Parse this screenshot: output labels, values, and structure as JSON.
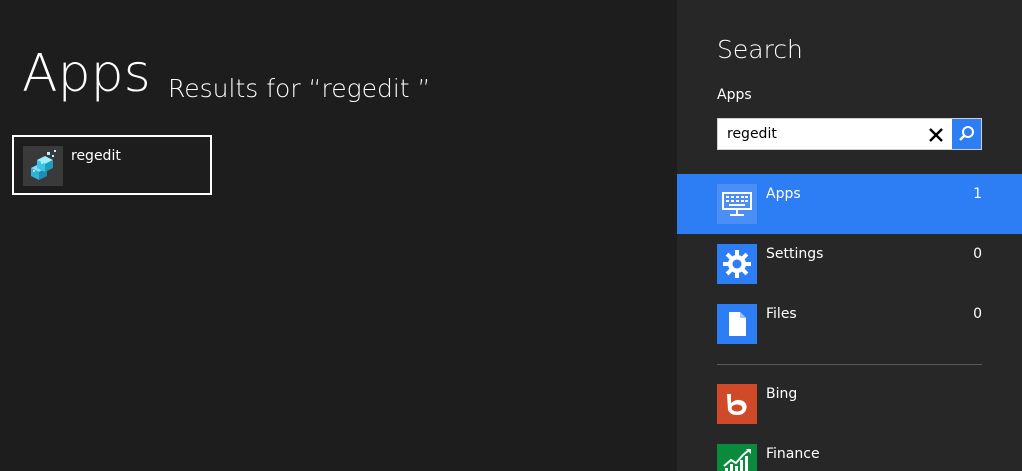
{
  "results": {
    "heading": "Apps",
    "results_for": "Results for “regedit ”",
    "items": [
      {
        "label": "regedit",
        "icon": "regedit-icon"
      }
    ]
  },
  "search": {
    "title": "Search",
    "scope": "Apps",
    "query": "regedit",
    "clear_icon": "close-icon",
    "search_icon": "search-icon"
  },
  "scopes": [
    {
      "label": "Apps",
      "count": "1",
      "icon": "apps-icon",
      "color": "#2d7df4",
      "selected": true
    },
    {
      "label": "Settings",
      "count": "0",
      "icon": "gear-icon",
      "color": "#2d7df4",
      "selected": false
    },
    {
      "label": "Files",
      "count": "0",
      "icon": "file-icon",
      "color": "#2d7df4",
      "selected": false
    }
  ],
  "apps": [
    {
      "label": "Bing",
      "icon": "bing-icon",
      "color": "#d04a2a"
    },
    {
      "label": "Finance",
      "icon": "finance-icon",
      "color": "#0a8a3c"
    }
  ],
  "colors": {
    "background": "#1d1d1d",
    "pane": "#272727",
    "accent": "#2d7df4"
  }
}
